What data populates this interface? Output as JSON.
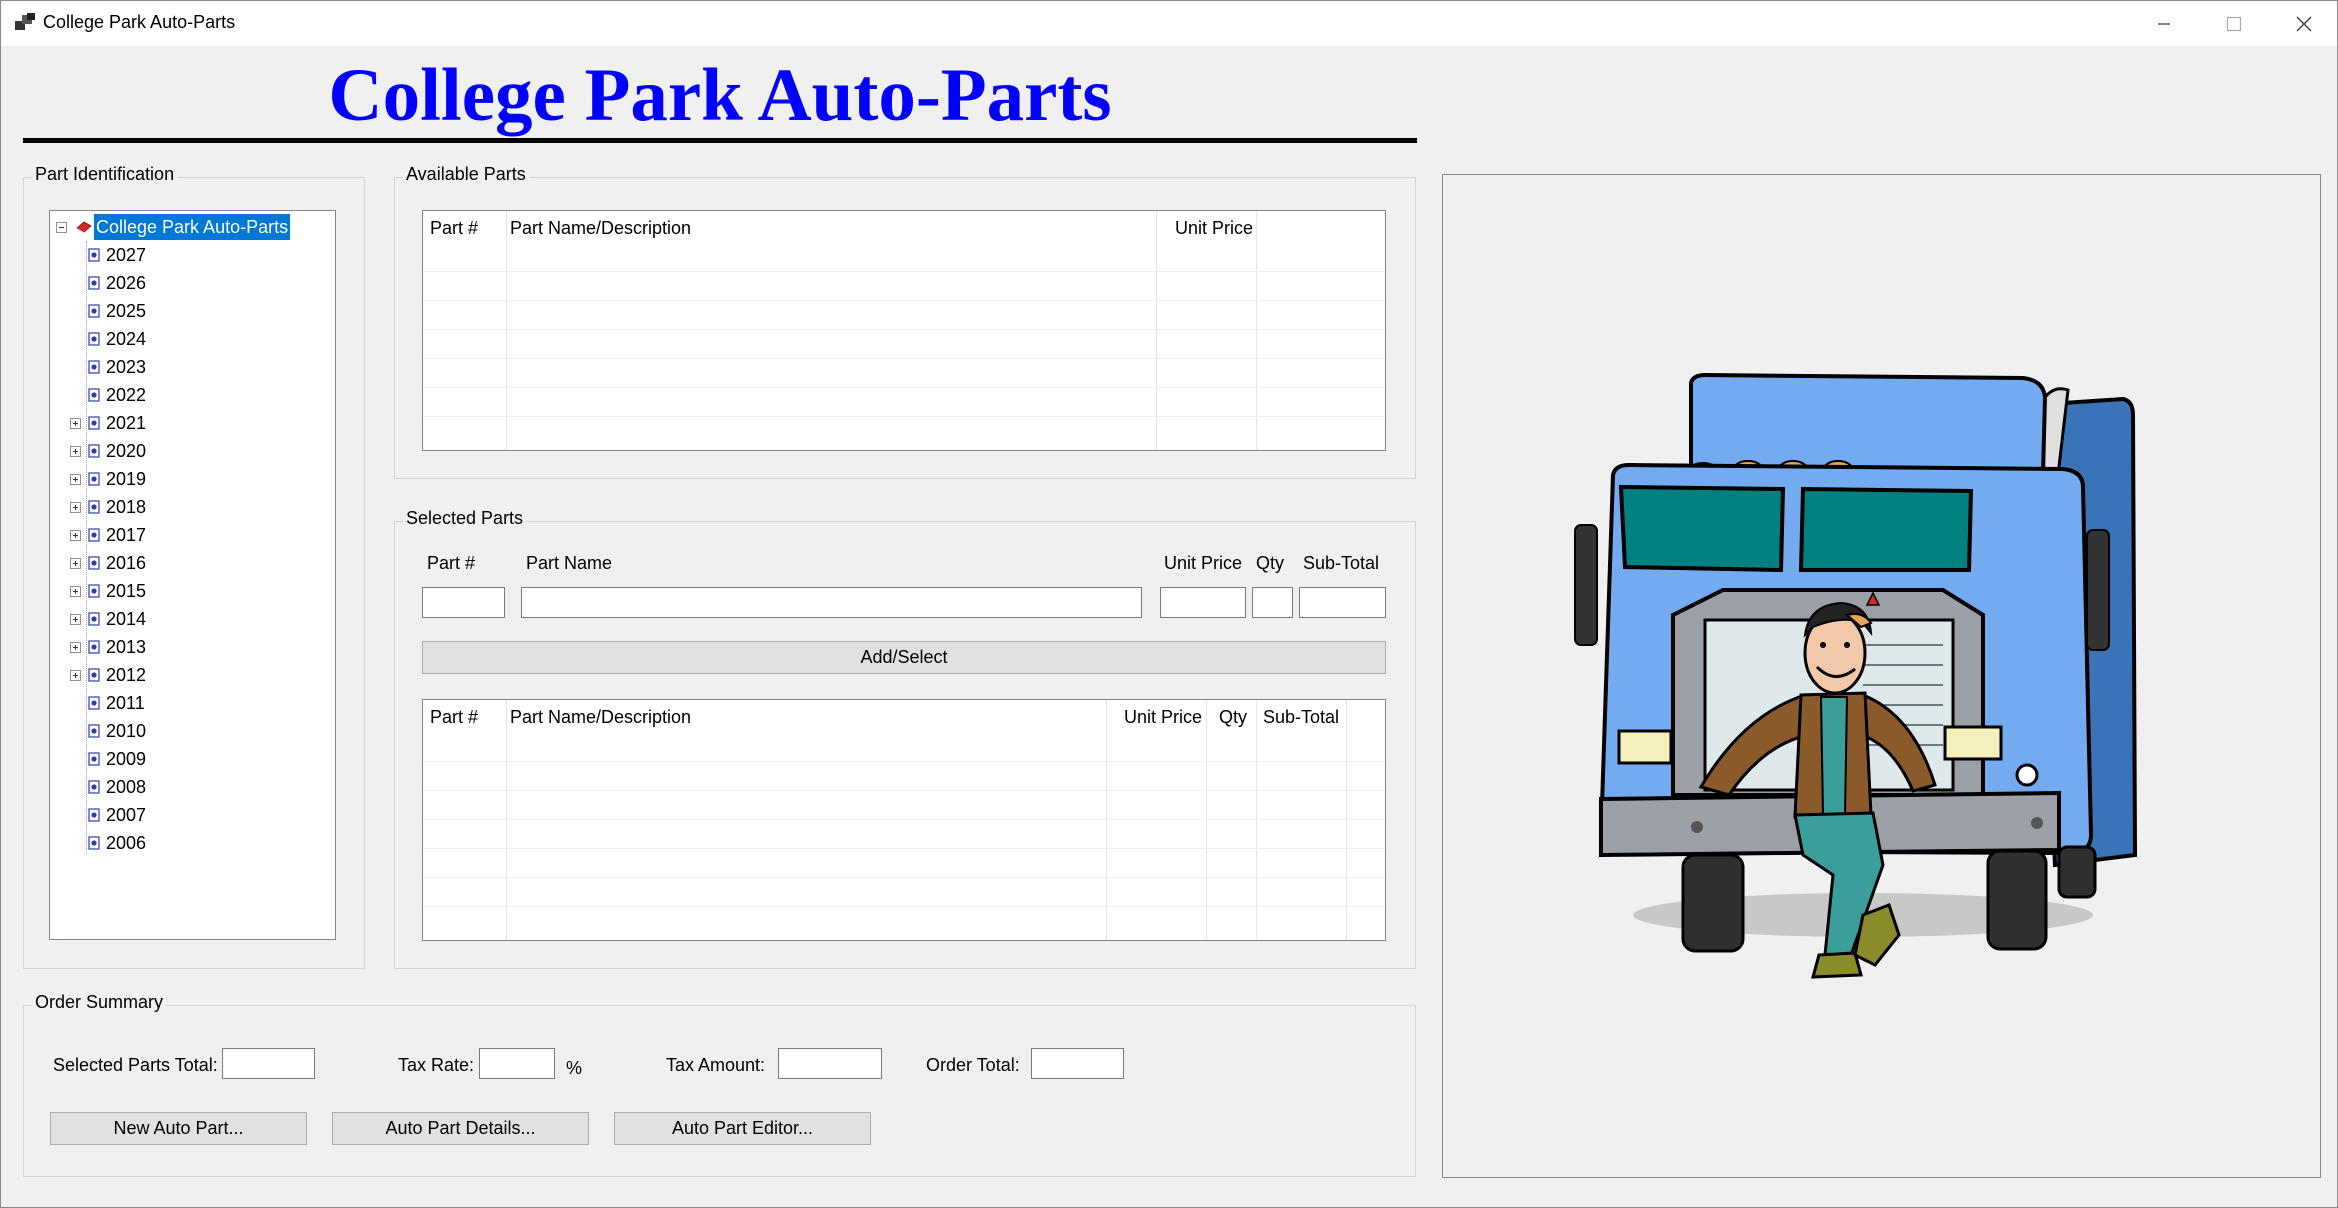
{
  "window": {
    "title": "College Park Auto-Parts",
    "controls": {
      "minimize": "—",
      "maximize": "☐",
      "close": "✕"
    }
  },
  "heading": "College Park Auto-Parts",
  "part_identification": {
    "title": "Part Identification",
    "root": "College Park Auto-Parts",
    "years": [
      {
        "label": "2027",
        "expandable": false
      },
      {
        "label": "2026",
        "expandable": false
      },
      {
        "label": "2025",
        "expandable": false
      },
      {
        "label": "2024",
        "expandable": false
      },
      {
        "label": "2023",
        "expandable": false
      },
      {
        "label": "2022",
        "expandable": false
      },
      {
        "label": "2021",
        "expandable": true
      },
      {
        "label": "2020",
        "expandable": true
      },
      {
        "label": "2019",
        "expandable": true
      },
      {
        "label": "2018",
        "expandable": true
      },
      {
        "label": "2017",
        "expandable": true
      },
      {
        "label": "2016",
        "expandable": true
      },
      {
        "label": "2015",
        "expandable": true
      },
      {
        "label": "2014",
        "expandable": true
      },
      {
        "label": "2013",
        "expandable": true
      },
      {
        "label": "2012",
        "expandable": true
      },
      {
        "label": "2011",
        "expandable": false
      },
      {
        "label": "2010",
        "expandable": false
      },
      {
        "label": "2009",
        "expandable": false
      },
      {
        "label": "2008",
        "expandable": false
      },
      {
        "label": "2007",
        "expandable": false
      },
      {
        "label": "2006",
        "expandable": false
      }
    ]
  },
  "available_parts": {
    "title": "Available Parts",
    "columns": [
      "Part #",
      "Part Name/Description",
      "Unit Price"
    ],
    "rows": []
  },
  "selected_parts": {
    "title": "Selected Parts",
    "entry_labels": {
      "part_no": "Part #",
      "part_name": "Part Name",
      "unit_price": "Unit Price",
      "qty": "Qty",
      "sub_total": "Sub-Total"
    },
    "entry_values": {
      "part_no": "",
      "part_name": "",
      "unit_price": "",
      "qty": "",
      "sub_total": ""
    },
    "add_button": "Add/Select",
    "columns": [
      "Part #",
      "Part Name/Description",
      "Unit Price",
      "Qty",
      "Sub-Total"
    ],
    "rows": []
  },
  "order_summary": {
    "title": "Order Summary",
    "selected_parts_total_label": "Selected Parts Total:",
    "selected_parts_total": "",
    "tax_rate_label": "Tax Rate:",
    "tax_rate": "",
    "percent_sign": "%",
    "tax_amount_label": "Tax Amount:",
    "tax_amount": "",
    "order_total_label": "Order Total:",
    "order_total": "",
    "buttons": {
      "new_part": "New Auto Part...",
      "details": "Auto Part Details...",
      "editor": "Auto Part Editor..."
    }
  },
  "colors": {
    "heading": "#0000ff",
    "selection": "#0078d7",
    "truck_body": "#74aaf0",
    "truck_side": "#3b73b8",
    "windshield": "#00807f"
  },
  "picture": {
    "subject-icon": "truck-with-mechanic-icon"
  }
}
